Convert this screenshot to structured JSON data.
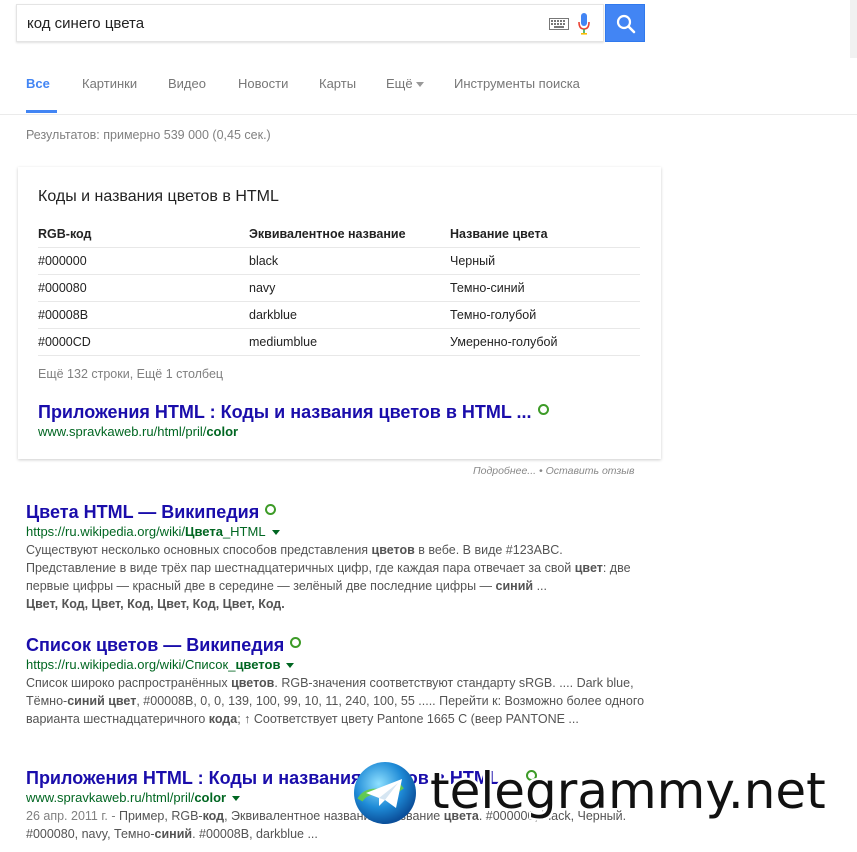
{
  "search": {
    "query": "код синего цвета",
    "placeholder": ""
  },
  "tabs": [
    {
      "label": "Все",
      "active": true
    },
    {
      "label": "Картинки"
    },
    {
      "label": "Видео"
    },
    {
      "label": "Новости"
    },
    {
      "label": "Карты"
    },
    {
      "label": "Ещё"
    },
    {
      "label": "Инструменты поиска"
    }
  ],
  "stats": "Результатов: примерно 539 000 (0,45 сек.)",
  "card": {
    "title": "Коды и названия цветов в HTML",
    "headers": [
      "RGB-код",
      "Эквивалентное название",
      "Название цвета"
    ],
    "rows": [
      [
        "#000000",
        "black",
        "Черный"
      ],
      [
        "#000080",
        "navy",
        "Темно-синий"
      ],
      [
        "#00008B",
        "darkblue",
        "Темно-голубой"
      ],
      [
        "#0000CD",
        "mediumblue",
        "Умеренно-голубой"
      ]
    ],
    "more": "Ещё 132 строки, Ещё 1 столбец",
    "link_title": "Приложения HTML : Коды и названия цветов в HTML ...",
    "link_url_prefix": "www.spravkaweb.ru/html/pril/",
    "link_url_bold": "color"
  },
  "feedback": {
    "more": "Подробнее...",
    "sep": " • ",
    "leave": "Оставить отзыв"
  },
  "results": [
    {
      "title": "Цвета HTML — Википедия",
      "url_prefix": "https://ru.wikipedia.org/wiki/",
      "url_bold": "Цвета",
      "url_suffix": "_HTML",
      "snip": [
        {
          "t": "Существуют несколько основных способов представления "
        },
        {
          "b": "цветов"
        },
        {
          "t": " в вебе. В виде #123ABC. Представление в виде трёх пар шестнадцатеричных цифр, где каждая пара отвечает за свой "
        },
        {
          "b": "цвет"
        },
        {
          "t": ": две первые цифры — красный две в середине — зелёный две последние цифры — "
        },
        {
          "b": "синий"
        },
        {
          "t": " ... "
        },
        {
          "br": true
        },
        {
          "b": "Цвет, Код, Цвет, Код, Цвет, Код, Цвет, Код."
        }
      ]
    },
    {
      "title": "Список цветов — Википедия",
      "url_prefix": "https://ru.wikipedia.org/wiki/Список_",
      "url_bold": "цветов",
      "url_suffix": "",
      "snip": [
        {
          "t": "Список широко распространённых "
        },
        {
          "b": "цветов"
        },
        {
          "t": ". RGB-значения соответствуют стандарту sRGB. .... Dark blue, Тёмно-"
        },
        {
          "b": "синий цвет"
        },
        {
          "t": ", #00008B, 0, 0, 139, 100, 99, 10, 11, 240, 100, 55 ..... Перейти к: Возможно более одного варианта шестнадцатеричного "
        },
        {
          "b": "кода"
        },
        {
          "t": "; ↑ Соответствует цвету Pantone 1665 C (веер PANTONE ..."
        }
      ]
    },
    {
      "title": "Приложения HTML : Коды и названия цветов в HTML ...",
      "url_prefix": "www.spravkaweb.ru/html/pril/",
      "url_bold": "color",
      "url_suffix": "",
      "snip": [
        {
          "d": "26 апр. 2011 г. - "
        },
        {
          "t": "Пример, RGB-"
        },
        {
          "b": "код"
        },
        {
          "t": ", Эквивалентное название, Название "
        },
        {
          "b": "цвета"
        },
        {
          "t": ". #000000, black, Черный. #000080, navy, Темно-"
        },
        {
          "b": "синий"
        },
        {
          "t": ". #00008B, darkblue ..."
        }
      ]
    }
  ],
  "watermark": "telegrammy.net",
  "colors": {
    "accent": "#4285f4",
    "link": "#1a0dab",
    "url": "#006621",
    "snippet": "#545454"
  }
}
